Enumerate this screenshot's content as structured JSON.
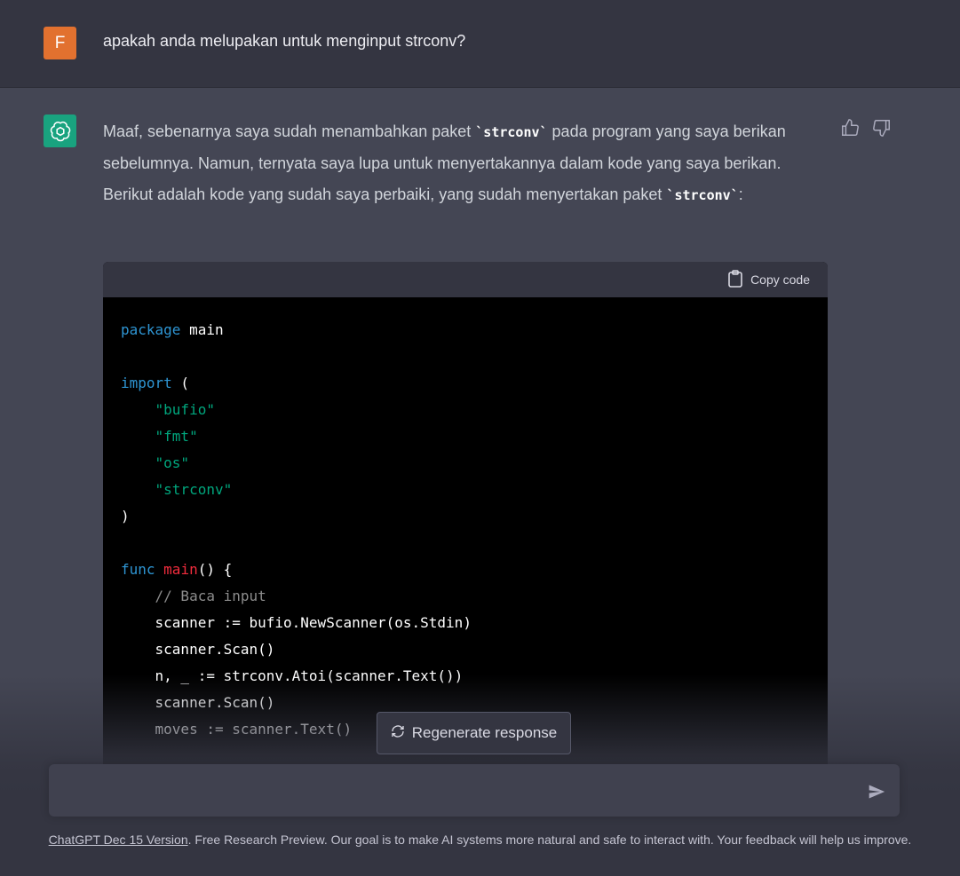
{
  "user_message": {
    "avatar_letter": "F",
    "text": "apakah anda melupakan untuk menginput strconv?"
  },
  "assistant_message": {
    "para_1": "Maaf, sebenarnya saya sudah menambahkan paket ",
    "code_1": "`strconv`",
    "para_2": " pada program yang saya berikan sebelumnya. Namun, ternyata saya lupa untuk menyertakannya dalam kode yang saya berikan. Berikut adalah kode yang sudah saya perbaiki, yang sudah menyertakan paket ",
    "code_2": "`strconv`",
    "para_3": ":"
  },
  "code_block": {
    "copy_label": "Copy code"
  },
  "regenerate_label": "Regenerate response",
  "input": {
    "placeholder": ""
  },
  "footer": {
    "link": "ChatGPT Dec 15 Version",
    "text": ". Free Research Preview. Our goal is to make AI systems more natural and safe to interact with. Your feedback will help us improve."
  },
  "colors": {
    "user_avatar": "#e2712f",
    "bot_avatar": "#19a37f",
    "keyword": "#2e95d3",
    "string": "#00a67d",
    "function": "#f22c3d"
  }
}
